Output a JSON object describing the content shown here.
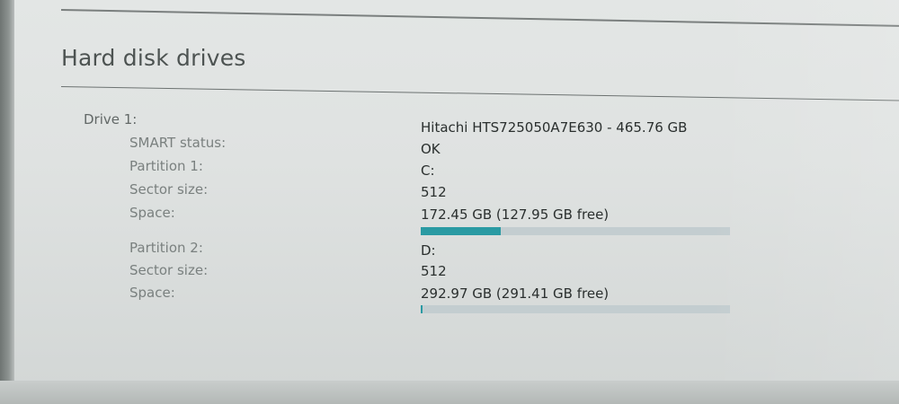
{
  "section": {
    "title": "Hard disk drives"
  },
  "drive": {
    "label": "Drive 1:",
    "name": "Hitachi HTS725050A7E630 - 465.76 GB",
    "smart_label": "SMART status:",
    "smart_value": "OK"
  },
  "partitions": [
    {
      "label": "Partition 1:",
      "letter": "C:",
      "sector_label": "Sector size:",
      "sector_value": "512",
      "space_label": "Space:",
      "space_value": "172.45 GB (127.95 GB free)",
      "used_fraction": 0.258
    },
    {
      "label": "Partition 2:",
      "letter": "D:",
      "sector_label": "Sector size:",
      "sector_value": "512",
      "space_label": "Space:",
      "space_value": "292.97 GB (291.41 GB free)",
      "used_fraction": 0.005
    }
  ],
  "colors": {
    "bar_fill": "#2a9aa3",
    "bar_track": "#c3cdd0"
  }
}
